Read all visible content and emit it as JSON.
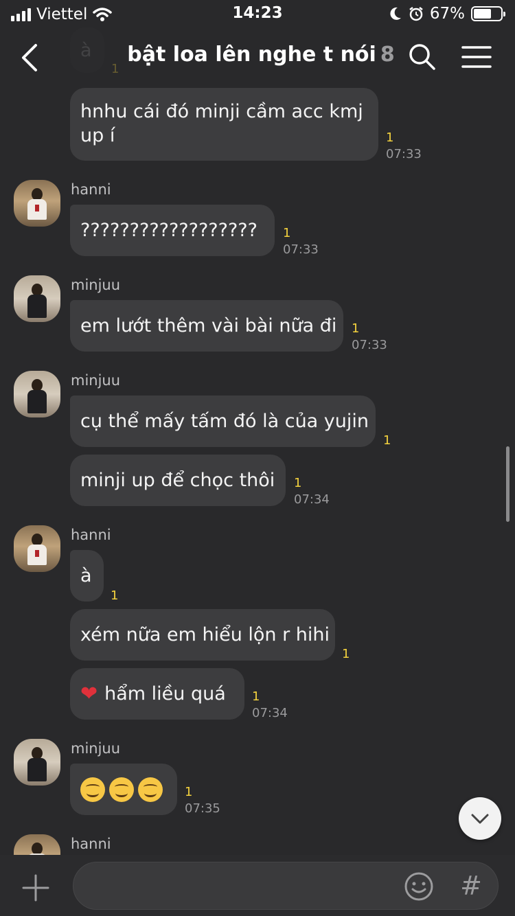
{
  "status_bar": {
    "carrier": "Viettel",
    "time": "14:23",
    "battery_text": "67%",
    "battery_level": 0.67
  },
  "header": {
    "title": "bật loa lên nghe t nói",
    "member_count": "8"
  },
  "top_partial": {
    "text": "à",
    "unread": "1"
  },
  "messages": [
    {
      "text": "hnhu cái đó minji cầm acc kmj",
      "text2": "up í",
      "unread": "1",
      "time": "07:33"
    },
    {
      "sender": "hanni",
      "text": "??????????????????",
      "unread": "1",
      "time": "07:33"
    },
    {
      "sender": "minjuu",
      "text": "em lướt thêm vài bài nữa đi",
      "unread": "1",
      "time": "07:33"
    },
    {
      "sender": "minjuu",
      "text": "cụ thể mấy tấm đó là của yujin",
      "unread": "1"
    },
    {
      "text": "minji up để chọc thôi",
      "unread": "1",
      "time": "07:34"
    },
    {
      "sender": "hanni",
      "text": "à",
      "unread": "1"
    },
    {
      "text": "xém nữa em hiểu lộn r hihi",
      "unread": "1"
    },
    {
      "text": "hẩm liều quá",
      "unread": "1",
      "time": "07:34",
      "emoji": "heart"
    },
    {
      "sender": "minjuu",
      "emoji": "smiling-face x3",
      "unread": "1",
      "time": "07:35"
    },
    {
      "sender": "hanni"
    }
  ],
  "input": {
    "placeholder": "",
    "hash_symbol": "#"
  },
  "colors": {
    "background": "#29292b",
    "bubble": "#3d3d3f",
    "unread": "#f4d23e",
    "time": "#9a9a9c"
  }
}
